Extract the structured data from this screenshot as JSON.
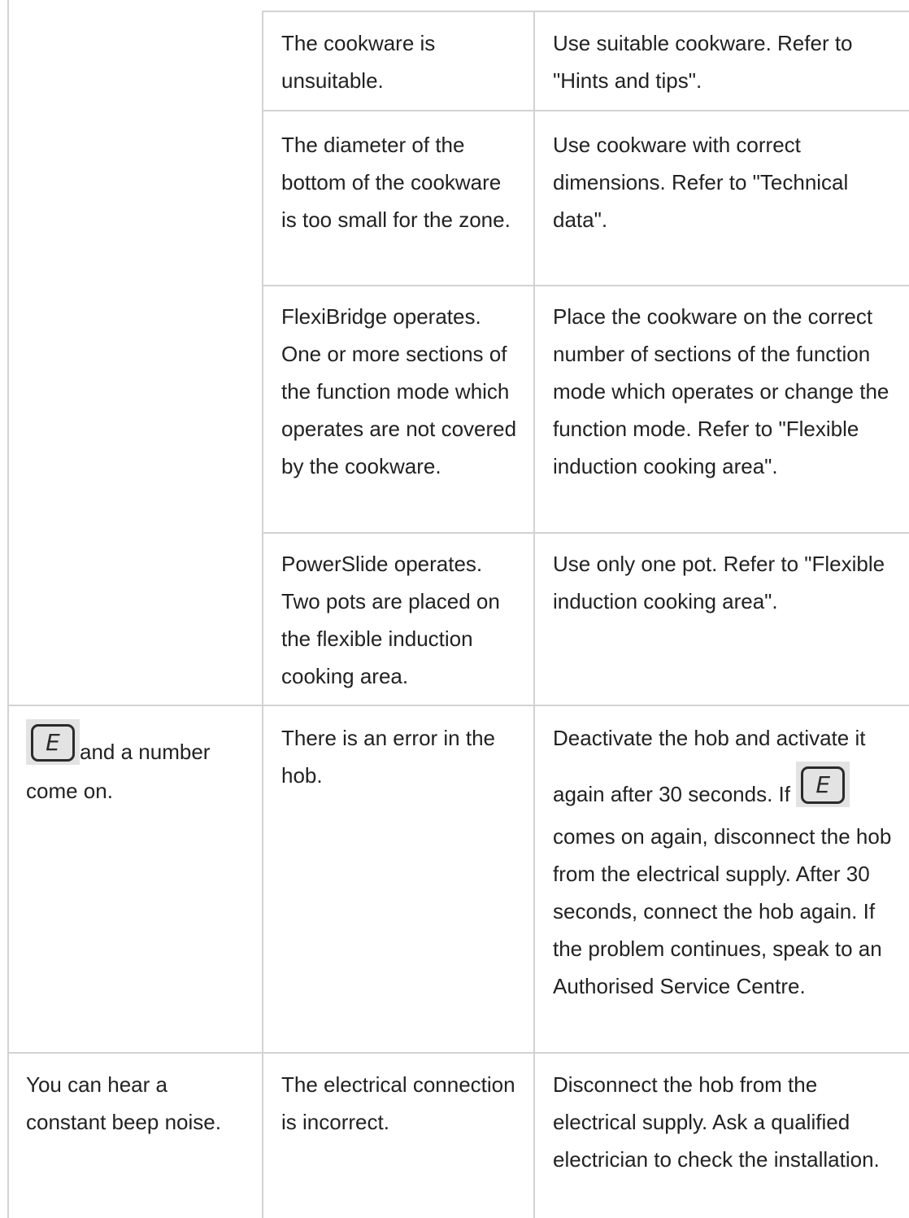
{
  "rows": [
    {
      "problem": "",
      "cause": "The cookware is unsuitable.",
      "remedy": "Use suitable cookware. Refer to \"Hints and tips\"."
    },
    {
      "problem": "",
      "cause": "The diameter of the bottom of the cookware is too small for the zone.",
      "remedy": "Use cookware with correct dimensions. Refer to \"Technical data\"."
    },
    {
      "problem": "",
      "cause": "FlexiBridge operates. One or more sections of the function mode which operates are not covered by the cookware.",
      "remedy": "Place the cookware on the correct number of sections of the function mode which operates or change the function mode. Refer to \"Flexible induction cooking area\"."
    },
    {
      "problem": "",
      "cause": "PowerSlide operates. Two pots are placed on the flexible induction cooking area.",
      "remedy": "Use only one pot. Refer to \"Flexible induction cooking area\"."
    },
    {
      "problem_icon": "error-code-e-icon",
      "problem": "and a number come on.",
      "cause": "There is an error in the hob.",
      "remedy_part1": "Deactivate the hob and activate it",
      "remedy_part2": "again after 30 seconds. If",
      "remedy_part3": "comes on again, disconnect the hob from the electrical supply. After 30 seconds, connect the hob again. If the problem continues, speak to an Authorised Service Centre."
    },
    {
      "problem": "You can hear a constant beep noise.",
      "cause": "The electrical connection is incorrect.",
      "remedy": "Disconnect the hob from the electrical supply. Ask a qualified electrician to check the installation."
    }
  ],
  "icon_letter": "E"
}
